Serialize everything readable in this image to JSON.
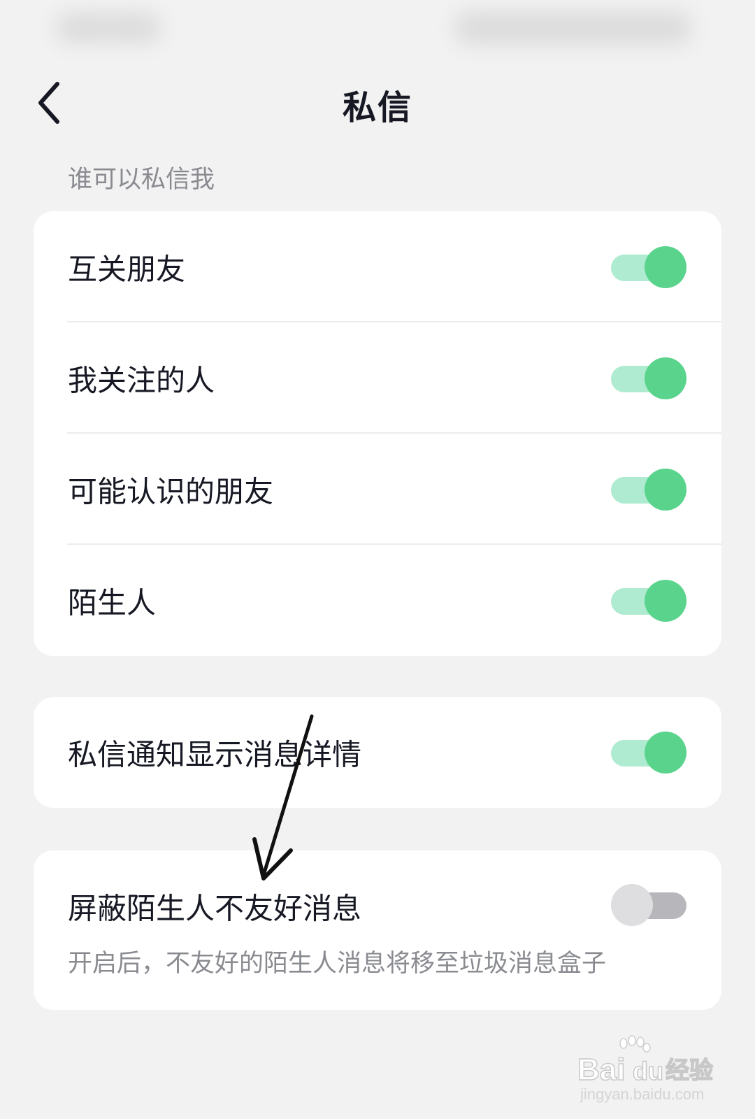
{
  "nav": {
    "title": "私信"
  },
  "section": {
    "label": "谁可以私信我"
  },
  "permissions": [
    {
      "label": "互关朋友",
      "enabled": true
    },
    {
      "label": "我关注的人",
      "enabled": true
    },
    {
      "label": "可能认识的朋友",
      "enabled": true
    },
    {
      "label": "陌生人",
      "enabled": true
    }
  ],
  "notification": {
    "label": "私信通知显示消息详情",
    "enabled": true
  },
  "block": {
    "label": "屏蔽陌生人不友好消息",
    "description": "开启后，不友好的陌生人消息将移至垃圾消息盒子",
    "enabled": false
  },
  "watermark": {
    "brand": "Bai",
    "brand_du": "du",
    "brand_cn": "经验",
    "url": "jingyan.baidu.com"
  },
  "colors": {
    "toggle_on_knob": "#5ad48d",
    "toggle_on_track": "#aeebd0",
    "toggle_off_knob": "#dedee0",
    "toggle_off_track": "#b7b7bb",
    "text_primary": "#161823",
    "text_secondary": "#8a8b91",
    "background": "#f2f2f2"
  },
  "icons": {
    "back": "chevron-left-icon",
    "annotation": "arrow-icon"
  }
}
